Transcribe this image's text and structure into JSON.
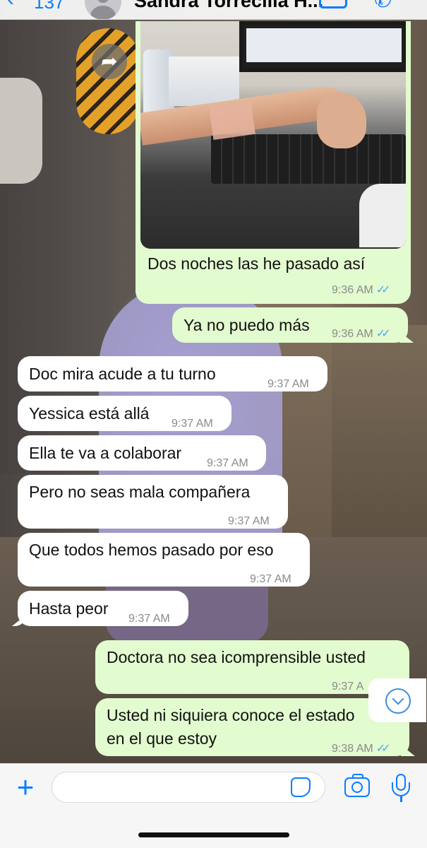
{
  "header": {
    "back_count": "137",
    "contact_name": "Sandra Torrecilla H..."
  },
  "messages": [
    {
      "direction": "outgoing",
      "type": "image",
      "text": "Dos noches las he pasado así",
      "time": "9:36 AM",
      "ticks": "✓✓"
    },
    {
      "direction": "outgoing",
      "text": "Ya no puedo más",
      "time": "9:36 AM",
      "ticks": "✓✓"
    },
    {
      "direction": "incoming",
      "text": "Doc mira acude a tu turno",
      "time": "9:37 AM"
    },
    {
      "direction": "incoming",
      "text": "Yessica está allá",
      "time": "9:37 AM"
    },
    {
      "direction": "incoming",
      "text": "Ella te va a colaborar",
      "time": "9:37 AM"
    },
    {
      "direction": "incoming",
      "text": "Pero no seas mala compañera",
      "time": "9:37 AM"
    },
    {
      "direction": "incoming",
      "text": "Que todos hemos pasado por eso",
      "time": "9:37 AM"
    },
    {
      "direction": "incoming",
      "text": "Hasta peor",
      "time": "9:37 AM"
    },
    {
      "direction": "outgoing",
      "text": "Doctora no sea icomprensible usted",
      "time": "9:37 A",
      "ticks": ""
    },
    {
      "direction": "outgoing",
      "text_line1": "Usted ni siquiera conoce el estado",
      "text_line2": "en el que estoy",
      "time": "9:38 AM",
      "ticks": "✓✓"
    }
  ],
  "input": {
    "value": "",
    "placeholder": ""
  },
  "icons": {
    "back": "chevron-left-icon",
    "video_call": "video-camera-icon",
    "voice_call": "phone-icon",
    "forward": "forward-icon",
    "scroll_down": "chevron-down-circle-icon",
    "attach": "plus-icon",
    "sticker": "sticker-icon",
    "camera": "camera-icon",
    "microphone": "microphone-icon"
  },
  "colors": {
    "accent": "#0a7cff",
    "outgoing_bubble": "#e2fbcf",
    "incoming_bubble": "#ffffff",
    "read_ticks": "#4fa8f0"
  }
}
